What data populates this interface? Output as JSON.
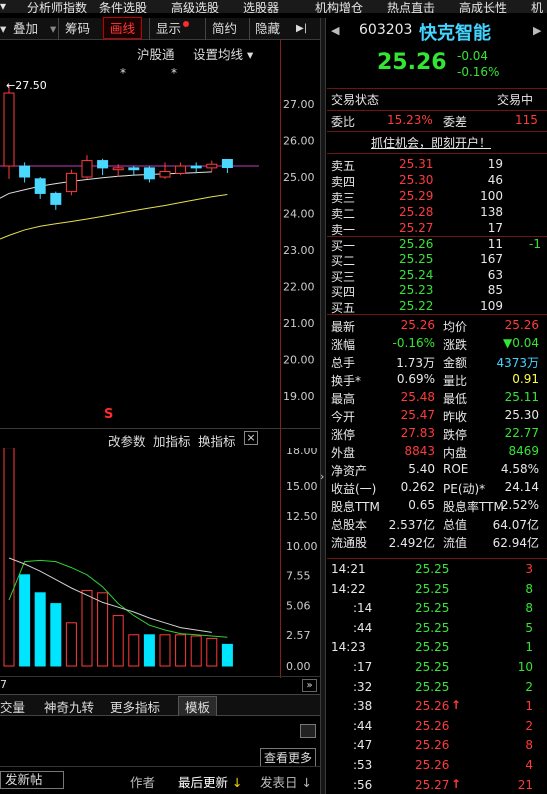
{
  "menu": [
    "分析师指数",
    "条件选股",
    "高级选股",
    "选股器",
    "机构增仓",
    "热点直击",
    "高成长性",
    "机"
  ],
  "toolbar": {
    "items": [
      "叠加",
      "筹码",
      "画线",
      "显示",
      "简约",
      "隐藏"
    ],
    "active": "画线",
    "nav_icon": "▶|"
  },
  "chart": {
    "links": [
      "沪股通",
      "设置均线"
    ],
    "high_marker": "←27.50",
    "price_axis": [
      "27.00",
      "26.00",
      "25.00",
      "24.00",
      "23.00",
      "22.00",
      "21.00",
      "20.00",
      "19.00"
    ],
    "candles": [
      {
        "o": 25.3,
        "h": 27.5,
        "l": 24.95,
        "c": 27.3
      },
      {
        "o": 25.3,
        "h": 25.4,
        "l": 24.85,
        "c": 25.0
      },
      {
        "o": 24.95,
        "h": 25.0,
        "l": 24.4,
        "c": 24.55
      },
      {
        "o": 24.55,
        "h": 24.6,
        "l": 24.1,
        "c": 24.25
      },
      {
        "o": 24.6,
        "h": 25.2,
        "l": 24.5,
        "c": 25.1
      },
      {
        "o": 25.0,
        "h": 25.6,
        "l": 24.95,
        "c": 25.45
      },
      {
        "o": 25.45,
        "h": 25.5,
        "l": 25.05,
        "c": 25.25
      },
      {
        "o": 25.2,
        "h": 25.35,
        "l": 25.0,
        "c": 25.25
      },
      {
        "o": 25.25,
        "h": 25.3,
        "l": 25.05,
        "c": 25.2
      },
      {
        "o": 25.25,
        "h": 25.3,
        "l": 24.85,
        "c": 24.95
      },
      {
        "o": 25.0,
        "h": 25.4,
        "l": 24.95,
        "c": 25.15
      },
      {
        "o": 25.1,
        "h": 25.4,
        "l": 25.05,
        "c": 25.3
      },
      {
        "o": 25.3,
        "h": 25.4,
        "l": 25.1,
        "c": 25.25
      },
      {
        "o": 25.25,
        "h": 25.45,
        "l": 25.15,
        "c": 25.35
      },
      {
        "o": 25.48,
        "h": 25.48,
        "l": 25.11,
        "c": 25.26
      }
    ],
    "ma_white": [
      24.55,
      24.65,
      24.75,
      24.82,
      24.88,
      24.93,
      24.98,
      25.02,
      25.05,
      25.07,
      25.09,
      25.1,
      25.12,
      25.14
    ],
    "ma_yellow": [
      23.4,
      23.55,
      23.65,
      23.72,
      23.78,
      23.85,
      23.92,
      24.0,
      24.08,
      24.15,
      24.22,
      24.3,
      24.38,
      24.46,
      24.52
    ],
    "last_close": 25.3,
    "stars": [
      "*",
      "*"
    ],
    "event_marker": "S"
  },
  "indicator": {
    "buttons": [
      "改参数",
      "加指标",
      "换指标"
    ],
    "close_icon": "×",
    "vol_axis": [
      "18.00",
      "15.00",
      "12.50",
      "10.00",
      "7.55",
      "5.06",
      "2.57",
      "0.00"
    ],
    "volumes": [
      18.2,
      7.6,
      6.1,
      5.2,
      3.6,
      6.3,
      6.1,
      4.2,
      2.6,
      2.6,
      2.6,
      2.6,
      2.5,
      2.3,
      1.8
    ],
    "vol_up": [
      true,
      false,
      false,
      false,
      true,
      true,
      true,
      true,
      true,
      false,
      true,
      true,
      true,
      true,
      false
    ],
    "ma_green": [
      5.5,
      8.7,
      8.8,
      8.7,
      8.2,
      7.6,
      6.6,
      5.2,
      4.2,
      3.4,
      3.0,
      2.7,
      2.6,
      2.5,
      2.4
    ],
    "ma_white": [
      9.0,
      8.5,
      7.9,
      7.2,
      6.5,
      5.9,
      5.3,
      4.9,
      4.5,
      4.0,
      3.6,
      3.2,
      3.0,
      2.8
    ],
    "scroll_label": "7"
  },
  "bottom_tabs": [
    "交量",
    "神奇九转",
    "更多指标",
    "模板"
  ],
  "bottom_selected": "模板",
  "more_label": "查看更多",
  "post": {
    "new": "发新帖",
    "author": "作者",
    "last_update": "最后更新",
    "post_date": "发表日"
  },
  "quote": {
    "code": "603203",
    "name": "快克智能",
    "price": "25.26",
    "change": "-0.04",
    "change_pct": "-0.16%",
    "status_label": "交易状态",
    "status_value": "交易中",
    "weibi_label": "委比",
    "weibi_value": "15.23%",
    "weicha_label": "委差",
    "weicha_value": "115",
    "ad": "抓住机会，即刻开户！",
    "asks": [
      {
        "label": "卖五",
        "price": "25.31",
        "vol": "19"
      },
      {
        "label": "卖四",
        "price": "25.30",
        "vol": "46"
      },
      {
        "label": "卖三",
        "price": "25.29",
        "vol": "100"
      },
      {
        "label": "卖二",
        "price": "25.28",
        "vol": "138"
      },
      {
        "label": "卖一",
        "price": "25.27",
        "vol": "17"
      }
    ],
    "bids": [
      {
        "label": "买一",
        "price": "25.26",
        "vol": "11",
        "delta": "-1"
      },
      {
        "label": "买二",
        "price": "25.25",
        "vol": "167",
        "delta": ""
      },
      {
        "label": "买三",
        "price": "25.24",
        "vol": "63",
        "delta": ""
      },
      {
        "label": "买四",
        "price": "25.23",
        "vol": "85",
        "delta": ""
      },
      {
        "label": "买五",
        "price": "25.22",
        "vol": "109",
        "delta": ""
      }
    ],
    "stats": [
      [
        "最新",
        "25.26",
        "均价",
        "25.26"
      ],
      [
        "涨幅",
        "-0.16%",
        "涨跌",
        "▼0.04"
      ],
      [
        "总手",
        "1.73万",
        "金额",
        "4373万"
      ],
      [
        "换手*",
        "0.69%",
        "量比",
        "0.91"
      ],
      [
        "最高",
        "25.48",
        "最低",
        "25.11"
      ],
      [
        "今开",
        "25.47",
        "昨收",
        "25.30"
      ],
      [
        "涨停",
        "27.83",
        "跌停",
        "22.77"
      ],
      [
        "外盘",
        "8843",
        "内盘",
        "8469"
      ],
      [
        "净资产",
        "5.40",
        "ROE",
        "4.58%"
      ],
      [
        "收益(一)",
        "0.262",
        "PE(动)*",
        "24.14"
      ],
      [
        "股息TTM",
        "0.65",
        "股息率TTM",
        "2.52%"
      ],
      [
        "总股本",
        "2.537亿",
        "总值",
        "64.07亿"
      ],
      [
        "流通股",
        "2.492亿",
        "流值",
        "62.94亿"
      ]
    ],
    "stat_colors": [
      [
        "red",
        "red"
      ],
      [
        "green",
        "green"
      ],
      [
        "white",
        "cyan"
      ],
      [
        "white",
        "yellow"
      ],
      [
        "red",
        "green"
      ],
      [
        "red",
        "white"
      ],
      [
        "red",
        "green"
      ],
      [
        "red",
        "green"
      ],
      [
        "white",
        "white"
      ],
      [
        "white",
        "white"
      ],
      [
        "white",
        "white"
      ],
      [
        "white",
        "white"
      ],
      [
        "white",
        "white"
      ]
    ],
    "ticks": [
      {
        "time": "14:21",
        "price": "25.25",
        "vol": "3",
        "arrow": "",
        "vc": "red"
      },
      {
        "time": "14:22",
        "price": "25.25",
        "vol": "8",
        "arrow": "",
        "vc": "green"
      },
      {
        "time": ":14",
        "price": "25.25",
        "vol": "8",
        "arrow": "",
        "vc": "green"
      },
      {
        "time": ":44",
        "price": "25.25",
        "vol": "5",
        "arrow": "",
        "vc": "green"
      },
      {
        "time": "14:23",
        "price": "25.25",
        "vol": "1",
        "arrow": "",
        "vc": "green"
      },
      {
        "time": ":17",
        "price": "25.25",
        "vol": "10",
        "arrow": "",
        "vc": "green"
      },
      {
        "time": ":32",
        "price": "25.25",
        "vol": "2",
        "arrow": "",
        "vc": "green"
      },
      {
        "time": ":38",
        "price": "25.26",
        "vol": "1",
        "arrow": "↑",
        "vc": "red"
      },
      {
        "time": ":44",
        "price": "25.26",
        "vol": "2",
        "arrow": "",
        "vc": "red"
      },
      {
        "time": ":47",
        "price": "25.26",
        "vol": "8",
        "arrow": "",
        "vc": "red"
      },
      {
        "time": ":53",
        "price": "25.26",
        "vol": "4",
        "arrow": "",
        "vc": "red"
      },
      {
        "time": ":56",
        "price": "25.27",
        "vol": "21",
        "arrow": "↑",
        "vc": "red"
      }
    ]
  }
}
